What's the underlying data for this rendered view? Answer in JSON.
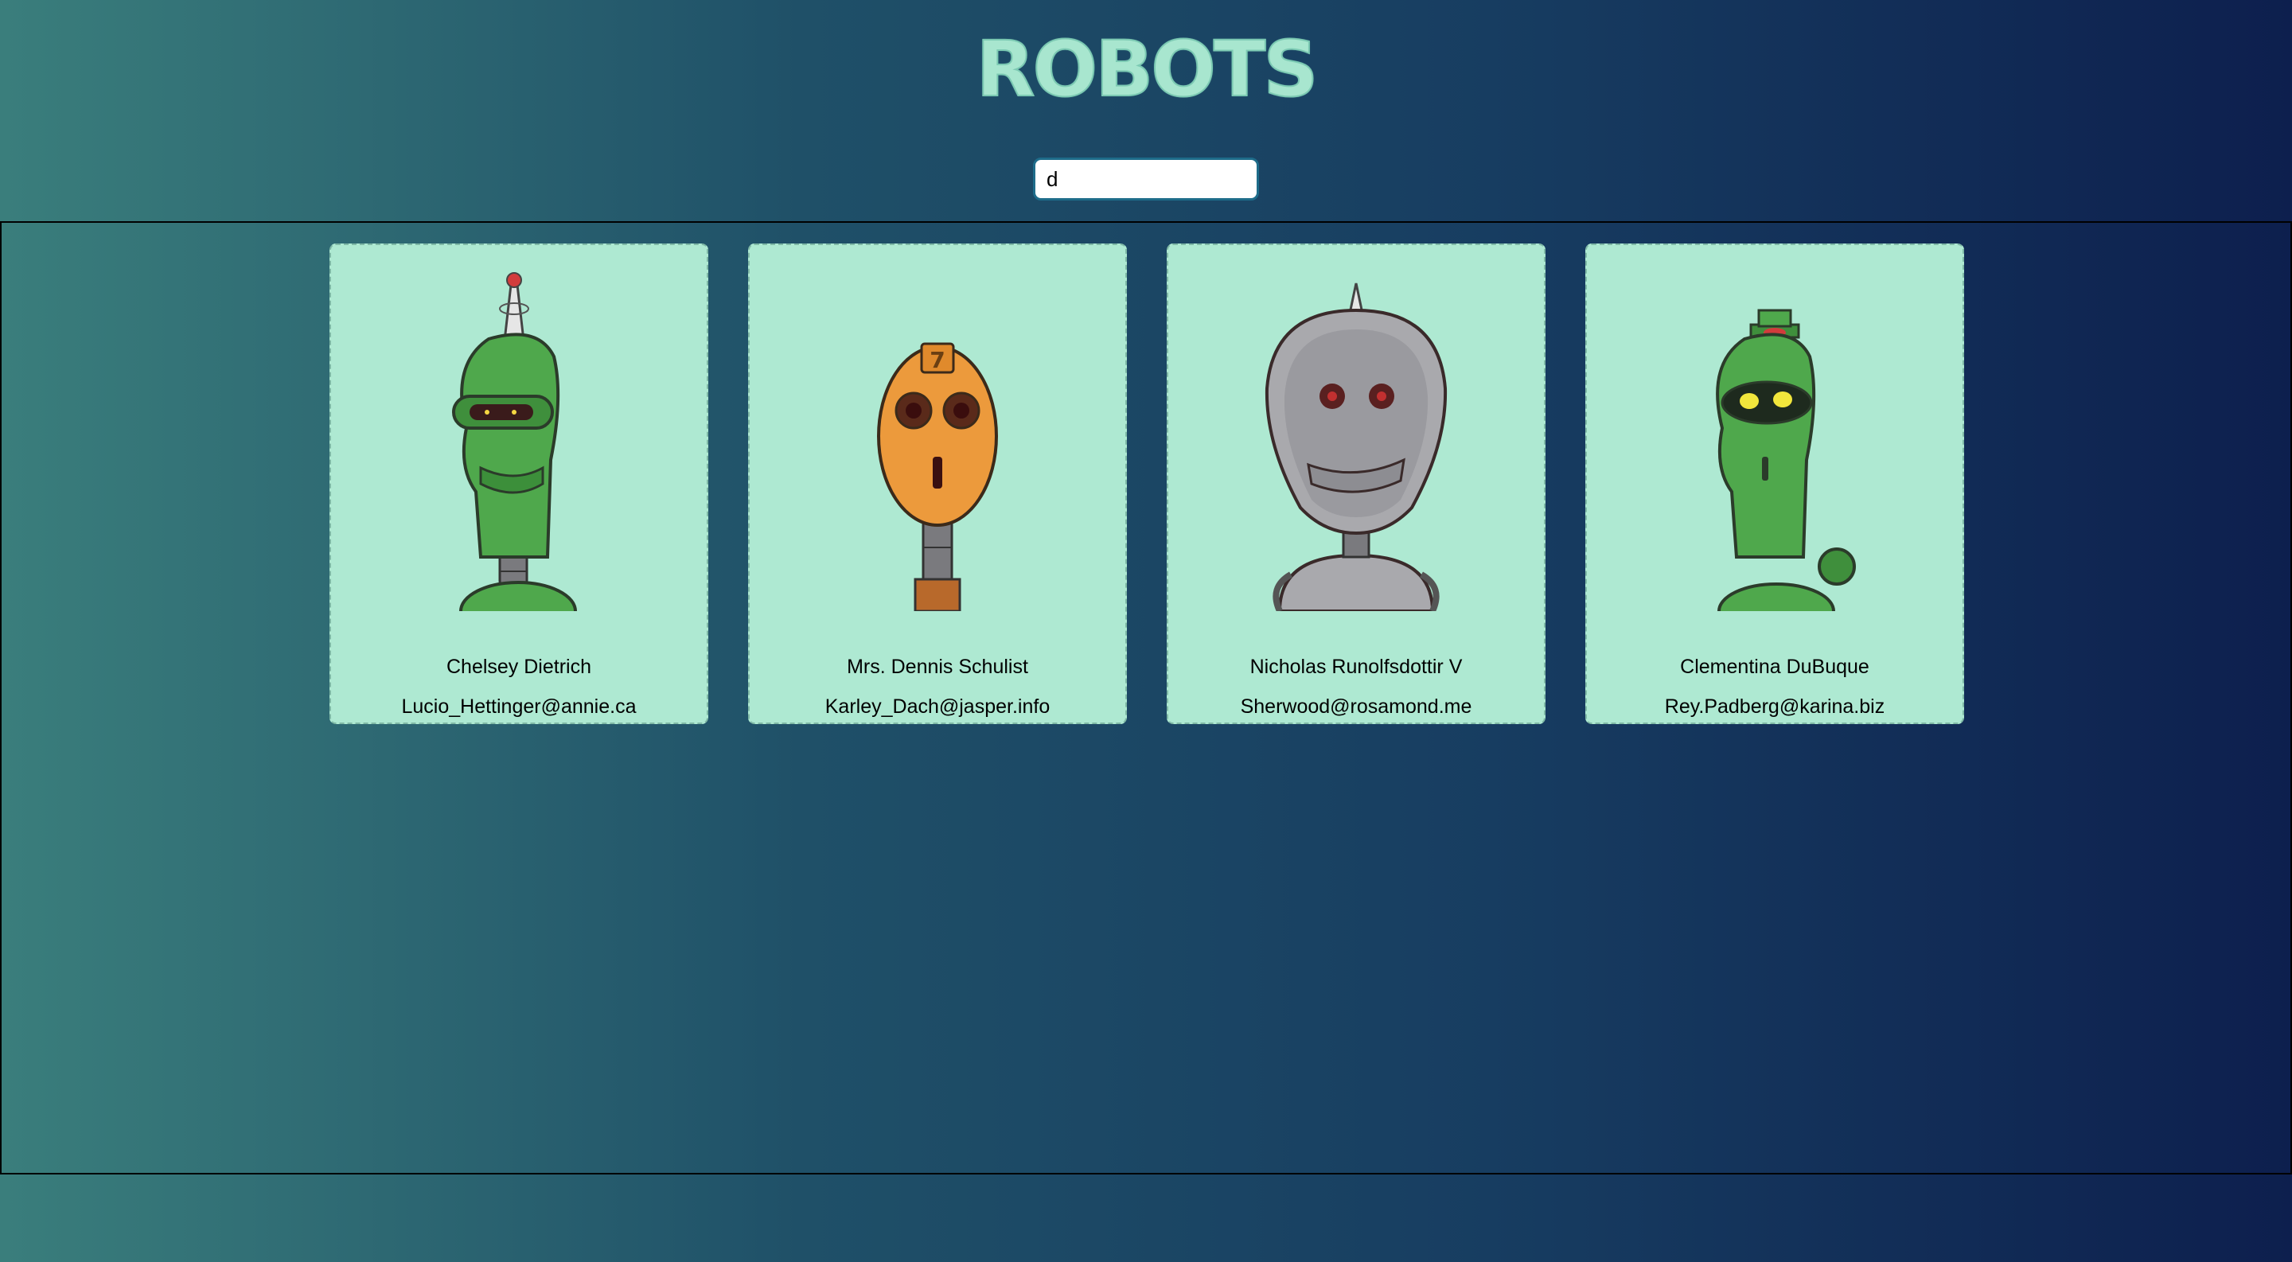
{
  "header": {
    "title": "ROBOTS"
  },
  "search": {
    "value": "d"
  },
  "robots": [
    {
      "name": "Chelsey Dietrich",
      "email": "Lucio_Hettinger@annie.ca",
      "color": "#4fa84c",
      "icon": "green-antenna-robot-icon"
    },
    {
      "name": "Mrs. Dennis Schulist",
      "email": "Karley_Dach@jasper.info",
      "color": "#ec9a3c",
      "icon": "orange-robot-icon"
    },
    {
      "name": "Nicholas Runolfsdottir V",
      "email": "Sherwood@rosamond.me",
      "color": "#a9a9ad",
      "icon": "grey-robot-icon"
    },
    {
      "name": "Clementina DuBuque",
      "email": "Rey.Padberg@karina.biz",
      "color": "#4fa84c",
      "icon": "green-hat-robot-icon"
    }
  ]
}
